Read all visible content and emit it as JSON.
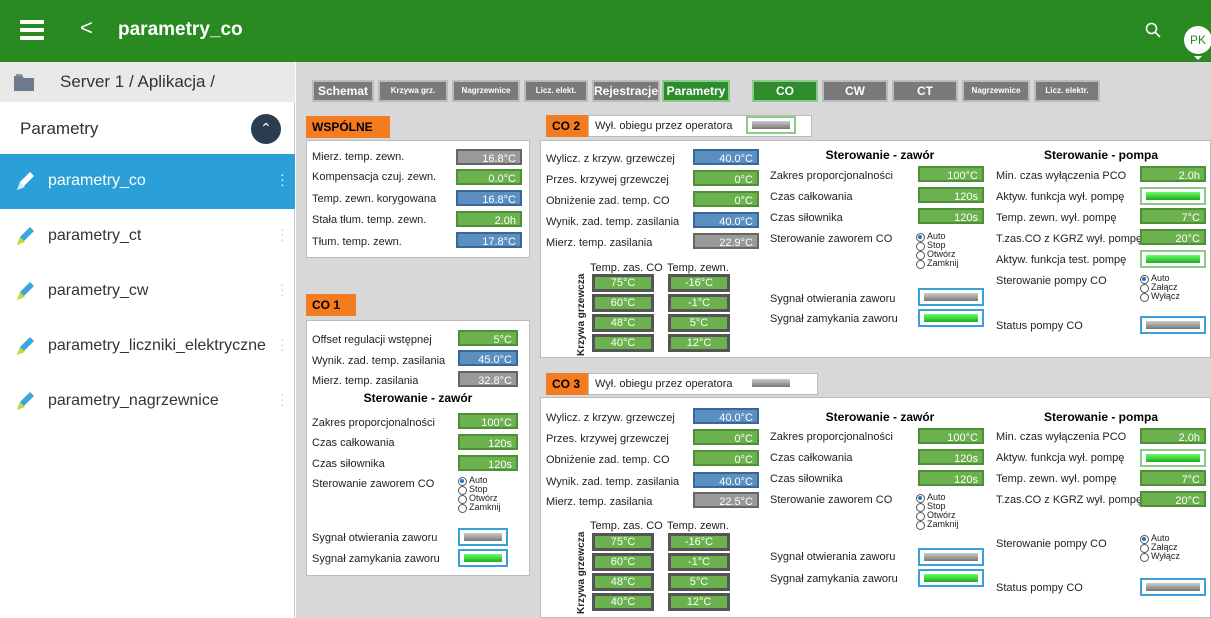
{
  "app": {
    "title": "parametry_co",
    "avatar": "PK",
    "back": "<"
  },
  "sidebar": {
    "server": "Server 1 / Aplikacja /",
    "section": "Parametry",
    "items": [
      {
        "label": "parametry_co",
        "active": true
      },
      {
        "label": "parametry_ct"
      },
      {
        "label": "parametry_cw"
      },
      {
        "label": "parametry_liczniki_elektryczne"
      },
      {
        "label": "parametry_nagrzewnice"
      }
    ]
  },
  "tabs": [
    "Schemat",
    "Krzywa grz.",
    "Nagrzewnice",
    "Licz. elekt.",
    "Rejestracje",
    "Parametry",
    "CO",
    "CW",
    "CT",
    "Nagrzewnice",
    "Licz. elektr."
  ],
  "wspolne": {
    "title": "WSPÓLNE",
    "rows": [
      {
        "label": "Mierz. temp. zewn.",
        "value": "16.8°C"
      },
      {
        "label": "Kompensacja czuj. zewn.",
        "value": "0.0°C"
      },
      {
        "label": "Temp. zewn. korygowana",
        "value": "16.8°C"
      },
      {
        "label": "Stała tłum. temp. zewn.",
        "value": "2.0h"
      },
      {
        "label": "Tłum. temp. zewn.",
        "value": "17.8°C"
      }
    ]
  },
  "co1": {
    "title": "CO 1",
    "rows": [
      {
        "label": "Offset regulacji wstępnej",
        "value": "5°C"
      },
      {
        "label": "Wynik. zad. temp. zasilania",
        "value": "45.0°C"
      },
      {
        "label": "Mierz. temp. zasilania",
        "value": "32.8°C"
      }
    ],
    "valve_header": "Sterowanie - zawór",
    "valve_rows": [
      {
        "label": "Zakres proporcjonalności",
        "value": "100°C"
      },
      {
        "label": "Czas całkowania",
        "value": "120s"
      },
      {
        "label": "Czas siłownika",
        "value": "120s"
      }
    ],
    "valve_ctrl": "Sterowanie zaworem CO",
    "open_sig": "Sygnał otwierania zaworu",
    "close_sig": "Sygnał zamykania zaworu"
  },
  "radios_valve": [
    "Auto",
    "Stop",
    "Otwórz",
    "Zamknij"
  ],
  "radios_pump": [
    "Auto",
    "Załącz",
    "Wyłącz"
  ],
  "co2": {
    "title": "CO 2",
    "bypass": "Wył. obiegu przez operatora",
    "left": [
      {
        "label": "Wylicz. z krzyw. grzewczej",
        "value": "40.0°C"
      },
      {
        "label": "Przes. krzywej grzewczej",
        "value": "0°C"
      },
      {
        "label": "Obniżenie zad. temp. CO",
        "value": "0°C"
      },
      {
        "label": "Wynik. zad. temp. zasilania",
        "value": "40.0°C"
      },
      {
        "label": "Mierz. temp. zasilania",
        "value": "22.9°C"
      }
    ],
    "curve_h1": "Temp. zas. CO",
    "curve_h2": "Temp. zewn.",
    "curve_label": "Krzywa grzewcza",
    "curve": [
      [
        "75°C",
        "-16°C"
      ],
      [
        "60°C",
        "-1°C"
      ],
      [
        "48°C",
        "5°C"
      ],
      [
        "40°C",
        "12°C"
      ]
    ],
    "valve_header": "Sterowanie - zawór",
    "valve": [
      {
        "label": "Zakres proporcjonalności",
        "value": "100°C"
      },
      {
        "label": "Czas całkowania",
        "value": "120s"
      },
      {
        "label": "Czas siłownika",
        "value": "120s"
      }
    ],
    "valve_ctrl": "Sterowanie zaworem CO",
    "open_sig": "Sygnał otwierania zaworu",
    "close_sig": "Sygnał zamykania zaworu",
    "pump_header": "Sterowanie - pompa",
    "pump": [
      {
        "label": "Min. czas wyłączenia PCO",
        "value": "2.0h"
      },
      {
        "label": "Aktyw. funkcja wył. pompę",
        "value": ""
      },
      {
        "label": "Temp. zewn. wył. pompę",
        "value": "7°C"
      },
      {
        "label": "T.zas.CO z KGRZ wył. pompę",
        "value": "20°C"
      },
      {
        "label": "Aktyw. funkcja test. pompę",
        "value": ""
      }
    ],
    "pump_ctrl": "Sterowanie pompy CO",
    "pump_status": "Status pompy CO"
  },
  "co3": {
    "title": "CO 3",
    "bypass": "Wył. obiegu przez operatora",
    "left": [
      {
        "label": "Wylicz. z krzyw. grzewczej",
        "value": "40.0°C"
      },
      {
        "label": "Przes. krzywej grzewczej",
        "value": "0°C"
      },
      {
        "label": "Obniżenie zad. temp. CO",
        "value": "0°C"
      },
      {
        "label": "Wynik. zad. temp. zasilania",
        "value": "40.0°C"
      },
      {
        "label": "Mierz. temp. zasilania",
        "value": "22.5°C"
      }
    ],
    "curve_h1": "Temp. zas. CO",
    "curve_h2": "Temp. zewn.",
    "curve_label": "Krzywa grzewcza",
    "curve": [
      [
        "75°C",
        "-16°C"
      ],
      [
        "60°C",
        "-1°C"
      ],
      [
        "48°C",
        "5°C"
      ],
      [
        "40°C",
        "12°C"
      ]
    ],
    "valve_header": "Sterowanie - zawór",
    "valve": [
      {
        "label": "Zakres proporcjonalności",
        "value": "100°C"
      },
      {
        "label": "Czas całkowania",
        "value": "120s"
      },
      {
        "label": "Czas siłownika",
        "value": "120s"
      }
    ],
    "valve_ctrl": "Sterowanie zaworem CO",
    "open_sig": "Sygnał otwierania zaworu",
    "close_sig": "Sygnał zamykania zaworu",
    "pump_header": "Sterowanie - pompa",
    "pump": [
      {
        "label": "Min. czas wyłączenia PCO",
        "value": "2.0h"
      },
      {
        "label": "Aktyw. funkcja wył. pompę",
        "value": ""
      },
      {
        "label": "Temp. zewn. wył. pompę",
        "value": "7°C"
      },
      {
        "label": "T.zas.CO z KGRZ wył. pompę",
        "value": "20°C"
      }
    ],
    "pump_ctrl": "Sterowanie pompy CO",
    "pump_status": "Status pompy CO"
  }
}
